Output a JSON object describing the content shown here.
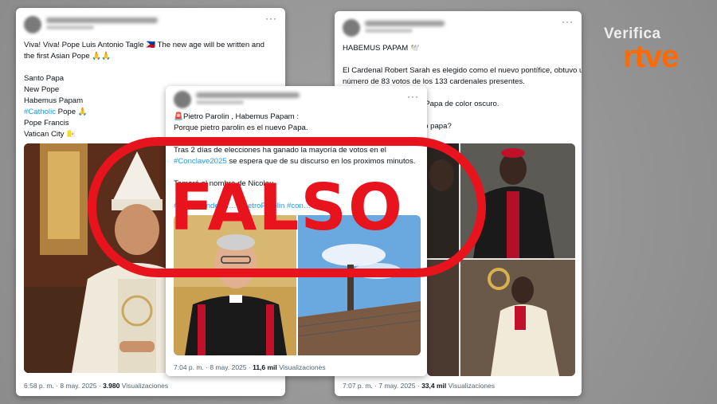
{
  "brand": {
    "top": "Verifica",
    "bottom": "rtve",
    "accent": "#ff6a00"
  },
  "stamp": {
    "text": "FALSO",
    "color": "#e8141d"
  },
  "tweet1": {
    "lines": [
      "Viva! Viva! Pope Luis Antonio Tagle 🇵🇭 The new age will be written and",
      "the first Asian Pope 🙏🙏",
      "",
      "Santo Papa",
      "New Pope",
      "Habemus Papam"
    ],
    "catholic_hashtag": "#Catholic",
    "catholic_rest": " Pope 🙏",
    "lines2": [
      "Pope Francis",
      "Vatican City 🇻🇦"
    ],
    "time": "6:58 p. m. · 8 may. 2025 · ",
    "views": "3.980",
    "views_label": " Visualizaciones"
  },
  "tweet2": {
    "line1": "🚨Pietro Parolin , Habemus Papam :",
    "line2": "Porque pietro parolin es el nuevo Papa.",
    "line3": "Tras 2 días de elecciones ha ganado la mayoría de votos en el",
    "hashtag": "#Conclave2025",
    "line4_rest": " se espera que de su discurso en los proximos minutos.",
    "line5": "Tomará el nombre de Nicolau.",
    "hash_line": "#RoTipTendenci…  …ietroParolin #con…",
    "time": "7:04 p. m. · 8 may. 2025 · ",
    "views": "11,6 mil",
    "views_label": " Visualizaciones"
  },
  "tweet3": {
    "title": "HABEMUS PAPAM 🕊️",
    "line1": "El Cardenal Robert Sarah es elegido como el nuevo pontífice, obtuvo un",
    "line2": "número de 83 votos de los 133 cardenales presentes.",
    "line3": "er Papa de color oscuro.",
    "line4": "evo papa?",
    "line5": "❤️ 🕊️ 🕊️ 🕊️",
    "time": "7:07 p. m. · 7 may. 2025 · ",
    "views": "33,4 mil",
    "views_label": " Visualizaciones"
  }
}
